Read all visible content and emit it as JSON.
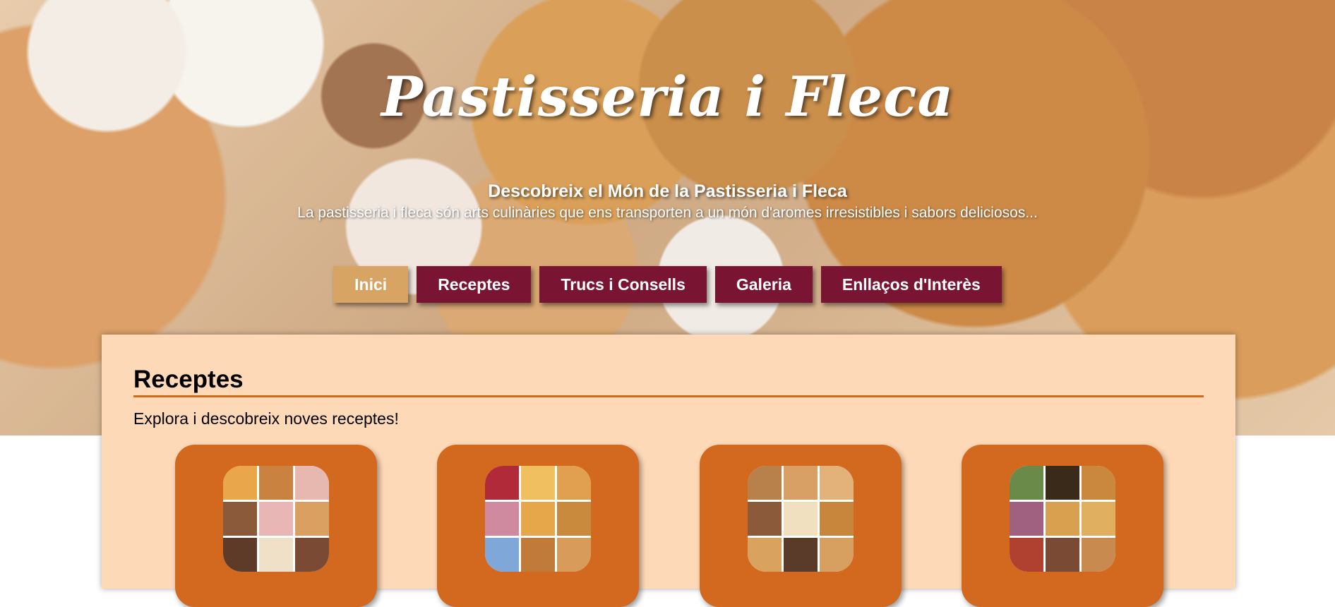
{
  "hero": {
    "title": "Pastisseria i Fleca",
    "subtitle": "Descobreix el Món de la Pastisseria i Fleca",
    "text": "La pastisseria i fleca són arts culinàries que ens transporten a un món d'aromes irresistibles i sabors deliciosos..."
  },
  "nav": {
    "items": [
      {
        "label": "Inici",
        "active": true
      },
      {
        "label": "Receptes",
        "active": false
      },
      {
        "label": "Trucs i Consells",
        "active": false
      },
      {
        "label": "Galeria",
        "active": false
      },
      {
        "label": "Enllaços d'Interès",
        "active": false
      }
    ]
  },
  "main": {
    "section_title": "Receptes",
    "section_description": "Explora i descobreix noves receptes!",
    "cards": [
      {
        "icon": "cakes-collage-image"
      },
      {
        "icon": "pastries-collage-image"
      },
      {
        "icon": "breads-collage-image"
      },
      {
        "icon": "desserts-collage-image"
      }
    ]
  },
  "colors": {
    "nav_background": "#7a1433",
    "nav_active": "#d8a464",
    "panel_background": "#fed9b7",
    "accent": "#d2691e"
  }
}
